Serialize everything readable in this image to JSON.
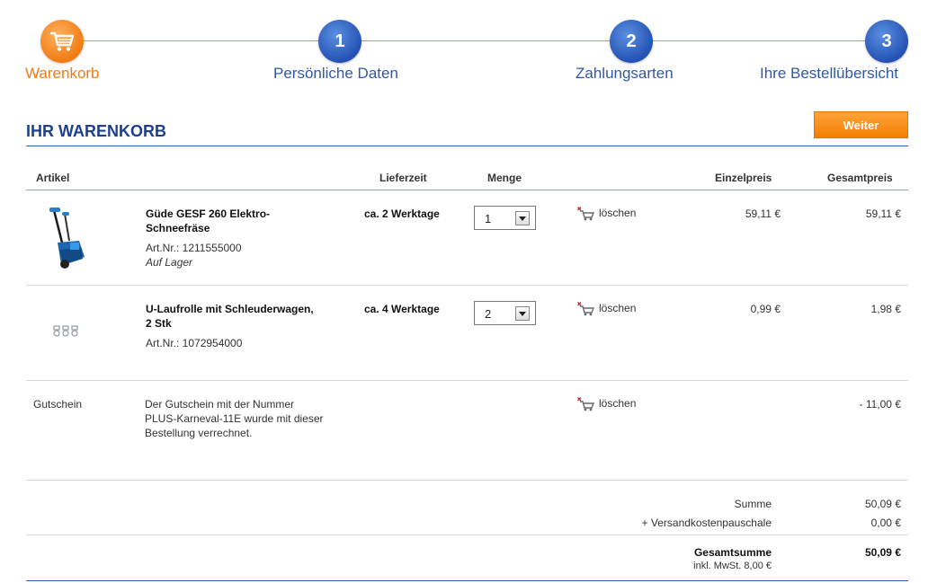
{
  "steps": [
    {
      "label": "Warenkorb",
      "number": ""
    },
    {
      "label": "Persönliche Daten",
      "number": "1"
    },
    {
      "label": "Zahlungsarten",
      "number": "2"
    },
    {
      "label": "Ihre Bestellübersicht",
      "number": "3"
    }
  ],
  "title": "IHR WARENKORB",
  "weiter_label": "Weiter",
  "headers": {
    "artikel": "Artikel",
    "lieferzeit": "Lieferzeit",
    "menge": "Menge",
    "einzelpreis": "Einzelpreis",
    "gesamtpreis": "Gesamtpreis"
  },
  "items": [
    {
      "name_line1": "Güde GESF 260 Elektro-",
      "name_line2": "Schneefräse",
      "artnr": "Art.Nr.: 1211555000",
      "stock": "Auf Lager",
      "delivery": "ca. 2 Werktage",
      "qty": "1",
      "delete": "löschen",
      "unit_price": "59,11 €",
      "total_price": "59,11 €"
    },
    {
      "name_line1": "U-Laufrolle mit Schleuderwagen,",
      "name_line2": "2 Stk",
      "artnr": "Art.Nr.: 1072954000",
      "stock": "",
      "delivery": "ca. 4 Werktage",
      "qty": "2",
      "delete": "löschen",
      "unit_price": "0,99 €",
      "total_price": "1,98 €"
    }
  ],
  "voucher": {
    "label": "Gutschein",
    "text_line1": "Der Gutschein mit der Nummer",
    "text_line2": "PLUS-Karneval-11E wurde mit dieser",
    "text_line3": "Bestellung verrechnet.",
    "delete": "löschen",
    "amount": "- 11,00 €"
  },
  "totals": {
    "summe_label": "Summe",
    "summe_value": "50,09 €",
    "shipping_label": "+ Versandkostenpauschale",
    "shipping_value": "0,00 €",
    "grand_label": "Gesamtsumme",
    "grand_value": "50,09 €",
    "vat_note": "inkl. MwSt. 8,00 €"
  },
  "colors": {
    "accent_orange": "#f07c12",
    "step_blue": "#2452b3",
    "title_blue": "#1e3f8e"
  }
}
